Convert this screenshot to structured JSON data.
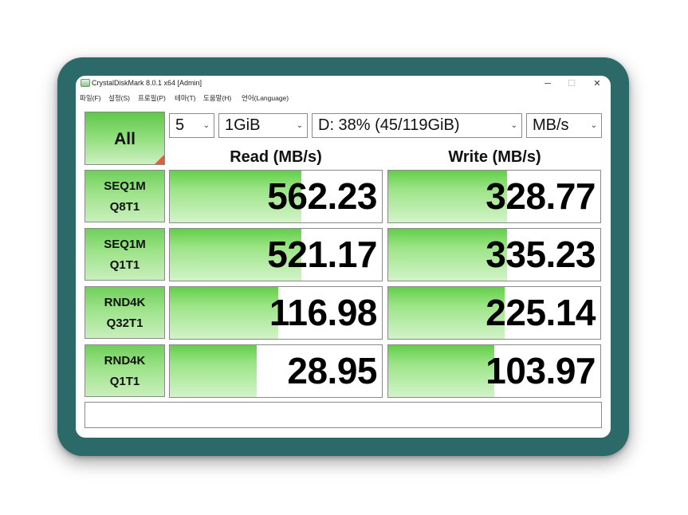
{
  "window": {
    "title": "CrystalDiskMark 8.0.1 x64 [Admin]",
    "minimize": "─",
    "maximize": "☐",
    "close": "✕"
  },
  "menu": [
    "파일(F)",
    "설정(S)",
    "프로필(P)",
    "테마(T)",
    "도움말(H)",
    "언어(Language)"
  ],
  "controls": {
    "all_button": "All",
    "count": "5",
    "size": "1GiB",
    "drive": "D: 38% (45/119GiB)",
    "unit": "MB/s"
  },
  "headers": {
    "read": "Read (MB/s)",
    "write": "Write (MB/s)"
  },
  "tests": [
    {
      "line1": "SEQ1M",
      "line2": "Q8T1",
      "read": "562.23",
      "write": "328.77",
      "read_fill": 0.62,
      "write_fill": 0.56
    },
    {
      "line1": "SEQ1M",
      "line2": "Q1T1",
      "read": "521.17",
      "write": "335.23",
      "read_fill": 0.62,
      "write_fill": 0.56
    },
    {
      "line1": "RND4K",
      "line2": "Q32T1",
      "read": "116.98",
      "write": "225.14",
      "read_fill": 0.51,
      "write_fill": 0.55
    },
    {
      "line1": "RND4K",
      "line2": "Q1T1",
      "read": "28.95",
      "write": "103.97",
      "read_fill": 0.41,
      "write_fill": 0.5
    }
  ],
  "comment": "",
  "colors": {
    "frame": "#2b6a68",
    "bar_green": "#62cf48",
    "corner_mark": "#e85b3a"
  }
}
